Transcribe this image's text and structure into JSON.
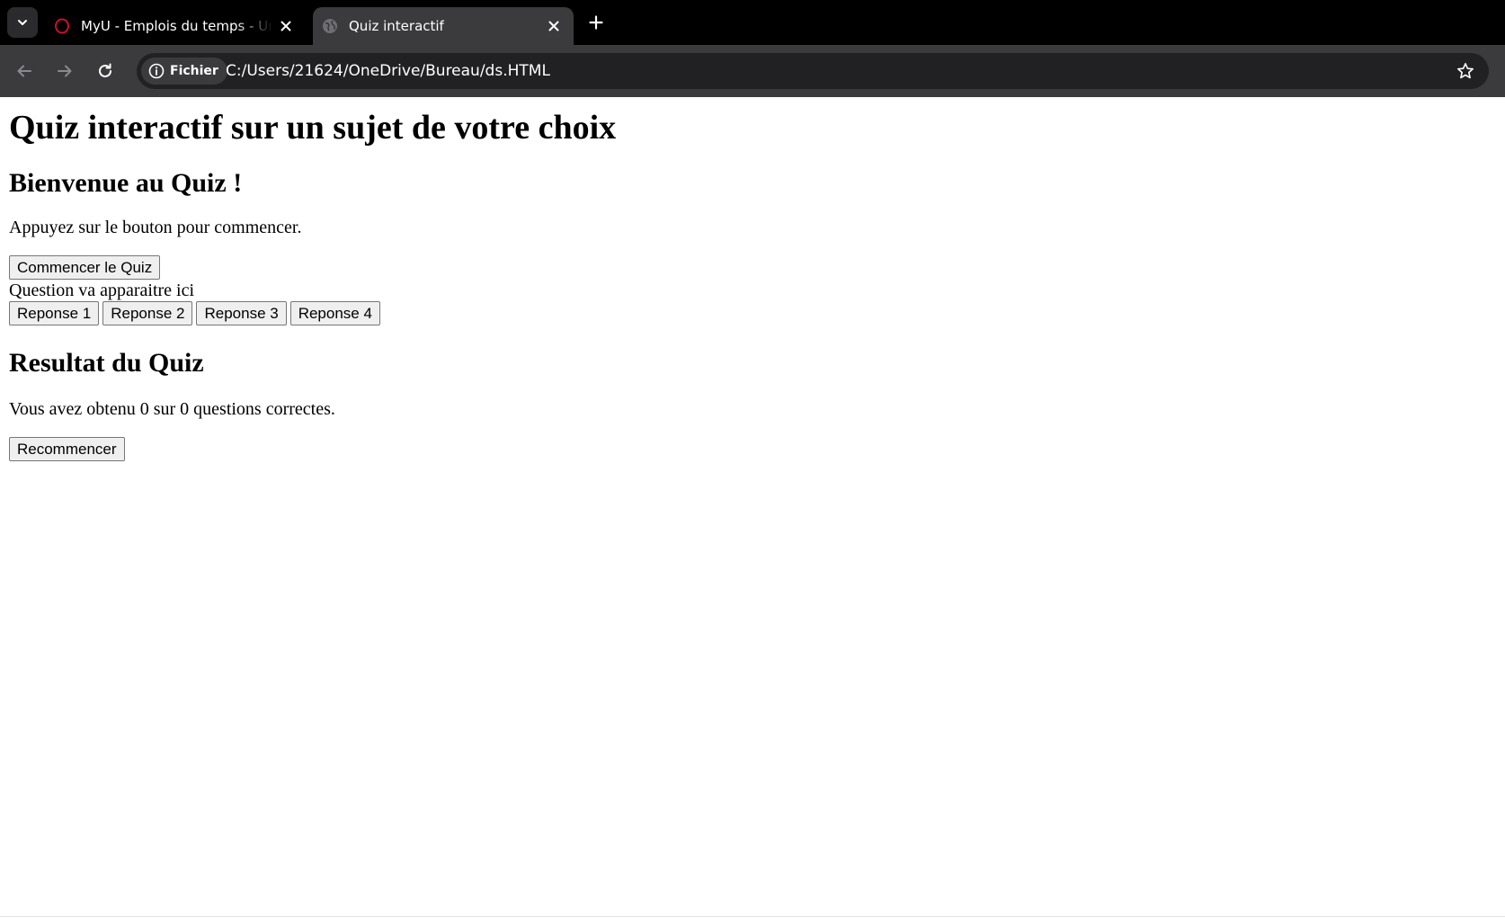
{
  "browser": {
    "tabs": [
      {
        "title": "MyU - Emplois du temps - Université",
        "favicon": "opera-o-icon",
        "active": false
      },
      {
        "title": "Quiz interactif",
        "favicon": "globe-icon",
        "active": true
      }
    ],
    "address": {
      "chip_label": "Fichier",
      "url": "C:/Users/21624/OneDrive/Bureau/ds.HTML"
    },
    "colors": {
      "tabstrip": "#000000",
      "toolbar": "#3b3b3d",
      "omnibox": "#212124",
      "favicon_accent": "#c8102e"
    }
  },
  "page": {
    "title": "Quiz interactif sur un sujet de votre choix",
    "welcome": {
      "heading": "Bienvenue au Quiz !",
      "text": "Appuyez sur le bouton pour commencer.",
      "start_button": "Commencer le Quiz"
    },
    "quiz": {
      "question": "Question va apparaitre ici",
      "answers": [
        "Reponse 1",
        "Reponse 2",
        "Reponse 3",
        "Reponse 4"
      ]
    },
    "result": {
      "heading": "Resultat du Quiz",
      "text": "Vous avez obtenu 0 sur 0 questions correctes.",
      "restart_button": "Recommencer"
    }
  }
}
